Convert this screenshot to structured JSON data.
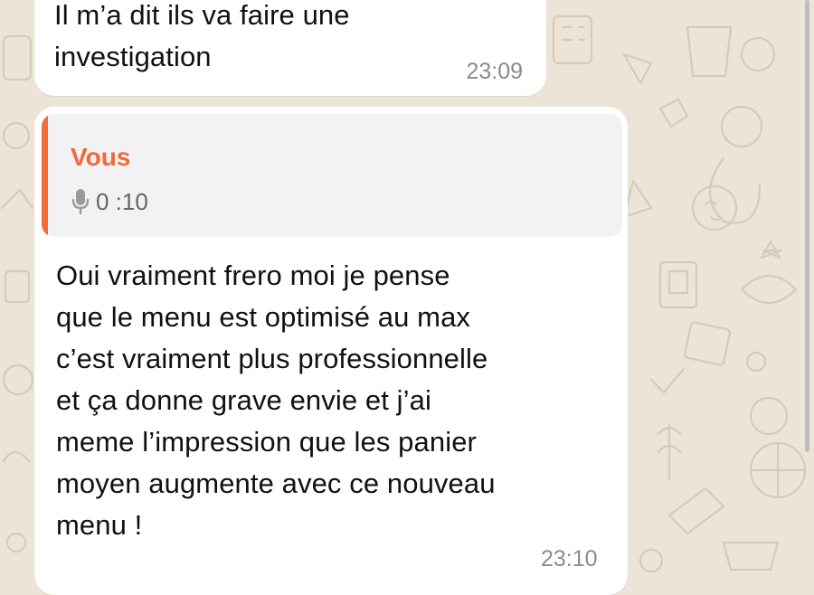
{
  "colors": {
    "wallpaper": "#ece4d6",
    "bubble": "#ffffff",
    "quote_accent": "#f26b3a",
    "quote_author": "#ef6a36",
    "text": "#111111",
    "timestamp": "#8b8b8b"
  },
  "messages": [
    {
      "text": "Il m’a dit ils va faire une\ninvestigation",
      "time": "23:09"
    },
    {
      "reply_to": {
        "author": "Vous",
        "icon": "mic-icon",
        "duration": "0 :10"
      },
      "text": "Oui vraiment frero moi je pense\nque le menu est optimisé au max\nc’est vraiment plus professionnelle\net ça donne grave envie et j’ai\nmeme l’impression que les panier\nmoyen augmente avec ce nouveau\nmenu !",
      "time": "23:10"
    }
  ]
}
